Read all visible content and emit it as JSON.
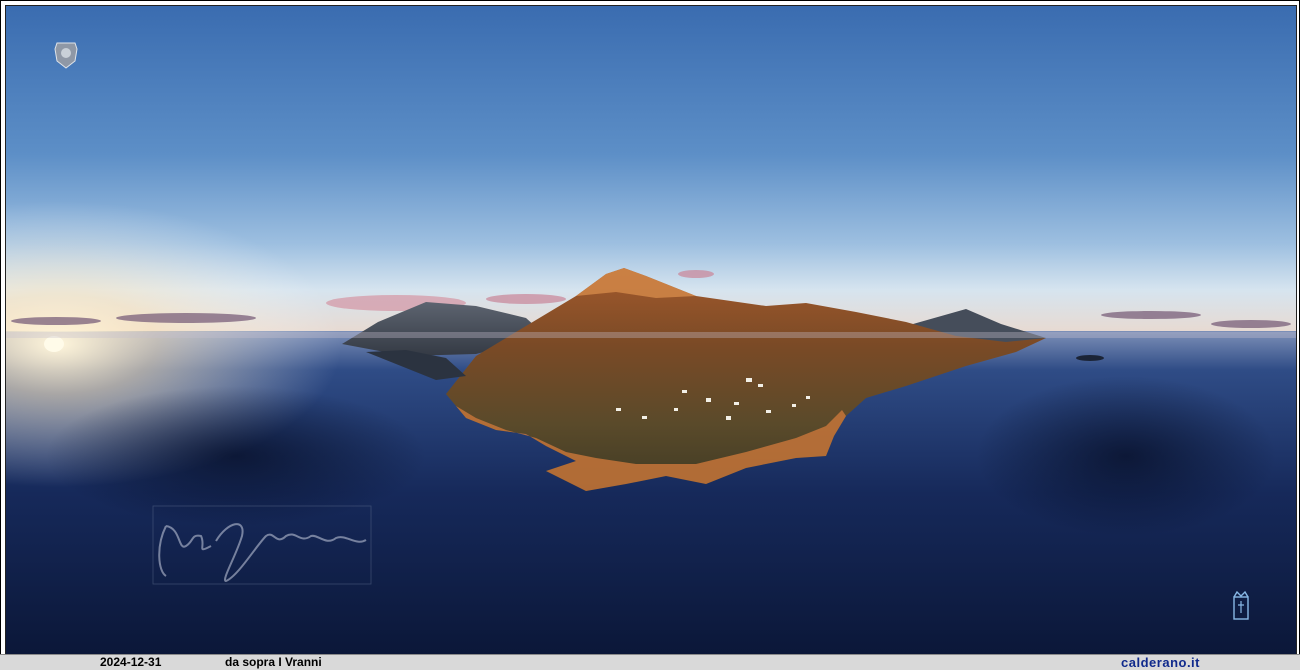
{
  "caption": {
    "date": "2024-12-31",
    "title": "da sopra I Vranni",
    "site": "calderano.it"
  },
  "colors": {
    "sky_top": "#3b6fb3",
    "sky_horizon": "#cfe0ee",
    "sea_deep": "#0d1d45",
    "sea_mid": "#23407a",
    "land_lit": "#b4632f",
    "land_shadow": "#3a3a2c",
    "caption_bar": "#d9d9d9",
    "site_text": "#102a8c"
  }
}
